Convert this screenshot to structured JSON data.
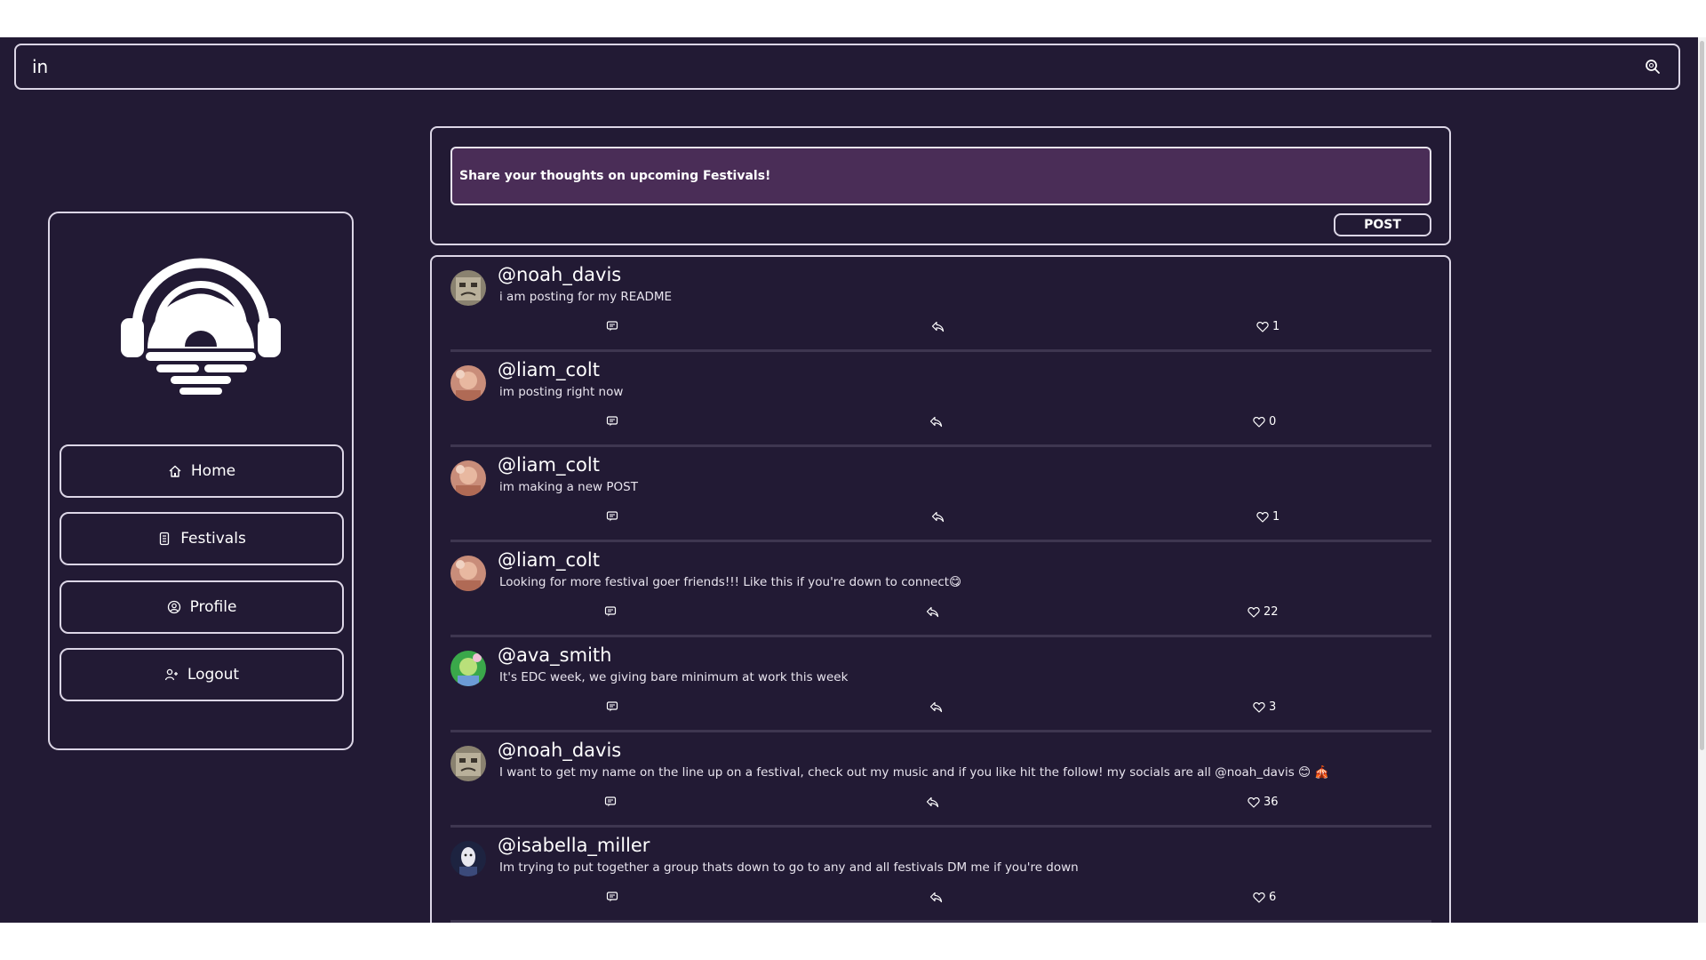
{
  "search": {
    "value": "in"
  },
  "compose": {
    "placeholder": "Share your thoughts on upcoming Festivals!",
    "post_label": "POST"
  },
  "nav": [
    {
      "label": "Home",
      "icon": "home-icon"
    },
    {
      "label": "Festivals",
      "icon": "ticket-icon"
    },
    {
      "label": "Profile",
      "icon": "user-circle-icon"
    },
    {
      "label": "Logout",
      "icon": "user-logout-icon"
    }
  ],
  "posts": [
    {
      "username": "@noah_davis",
      "text": "i am posting for my README",
      "likes": "1",
      "avatar": "noah"
    },
    {
      "username": "@liam_colt",
      "text": "im posting right now",
      "likes": "0",
      "avatar": "liam"
    },
    {
      "username": "@liam_colt",
      "text": "im making a new POST",
      "likes": "1",
      "avatar": "liam"
    },
    {
      "username": "@liam_colt",
      "text": "Looking for more festival goer friends!!! Like this if you're down to connect😋",
      "likes": "22",
      "avatar": "liam"
    },
    {
      "username": "@ava_smith",
      "text": "It's EDC week, we giving bare minimum at work this week",
      "likes": "3",
      "avatar": "ava"
    },
    {
      "username": "@noah_davis",
      "text": "I want to get my name on the line up on a festival, check out my music and if you like hit the follow! my socials are all @noah_davis 😊 🎪",
      "likes": "36",
      "avatar": "noah"
    },
    {
      "username": "@isabella_miller",
      "text": "Im trying to put together a group thats down to go to any and all festivals DM me if you're down",
      "likes": "6",
      "avatar": "isabella"
    }
  ],
  "colors": {
    "background": "#221a34",
    "border": "#dcd6e6",
    "compose_fill": "#4a2d57"
  }
}
